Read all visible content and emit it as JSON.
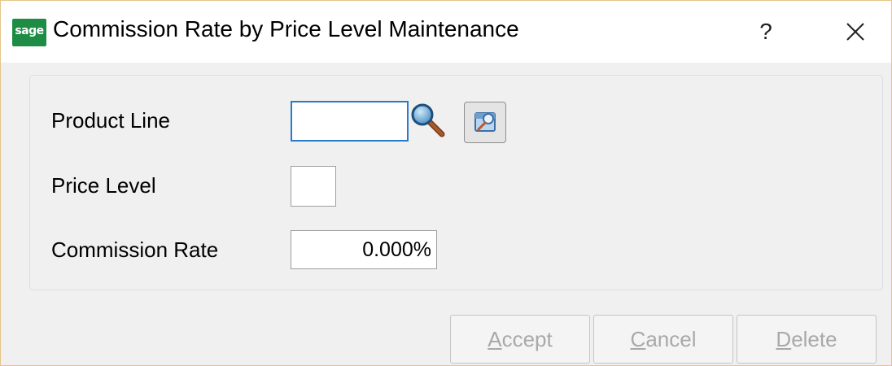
{
  "window": {
    "logo_text": "sage",
    "title": "Commission Rate by Price Level Maintenance",
    "help_label": "?",
    "close_icon": "close-x-icon"
  },
  "form": {
    "product_line": {
      "label": "Product Line",
      "value": "",
      "lookup_icon": "magnifier-icon",
      "browse_icon": "browse-folder-icon"
    },
    "price_level": {
      "label": "Price Level",
      "value": ""
    },
    "commission_rate": {
      "label": "Commission Rate",
      "value": "0.000%"
    }
  },
  "buttons": {
    "accept": {
      "mnemonic": "A",
      "rest": "ccept"
    },
    "cancel": {
      "mnemonic": "C",
      "rest": "ancel"
    },
    "delete": {
      "mnemonic": "D",
      "rest": "elete"
    }
  },
  "colors": {
    "logo_green": "#1e8c45",
    "focus_border": "#2b7ac9",
    "disabled_text": "#a9a9a9",
    "window_border": "#e6c488"
  }
}
